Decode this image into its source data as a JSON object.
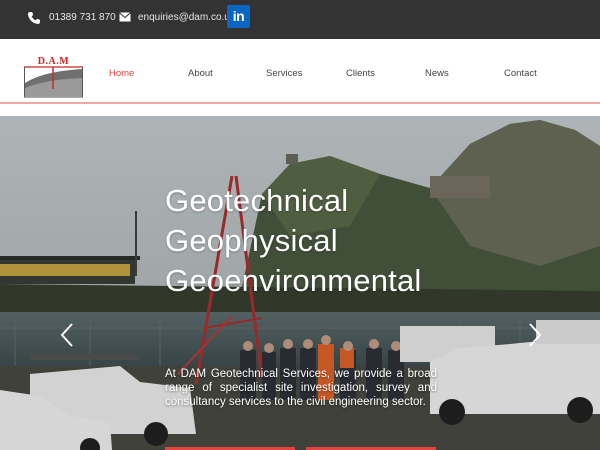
{
  "topbar": {
    "phone": "01389 731 870",
    "email": "enquiries@dam.co.uk",
    "linkedin_icon": "linkedin-icon",
    "background": "#333333"
  },
  "logo": {
    "text": "D.A.M"
  },
  "nav": {
    "items": [
      {
        "label": "Home",
        "active": true
      },
      {
        "label": "About",
        "active": false
      },
      {
        "label": "Services",
        "active": false
      },
      {
        "label": "Clients",
        "active": false
      },
      {
        "label": "News",
        "active": false
      },
      {
        "label": "Contact",
        "active": false
      }
    ],
    "active_color": "#e2433c"
  },
  "hero": {
    "titles": [
      "Geotechnical",
      "Geophysical",
      "Geoenvironmental"
    ],
    "body": "At DAM Geotechnical Services, we provide a broad range of specialist site investigation, survey and consultancy services to the civil engineering sector.",
    "prev_icon": "chevron-left-icon",
    "next_icon": "chevron-right-icon"
  },
  "colors": {
    "accent": "#e2433c",
    "divider": "#f0a9a5"
  }
}
